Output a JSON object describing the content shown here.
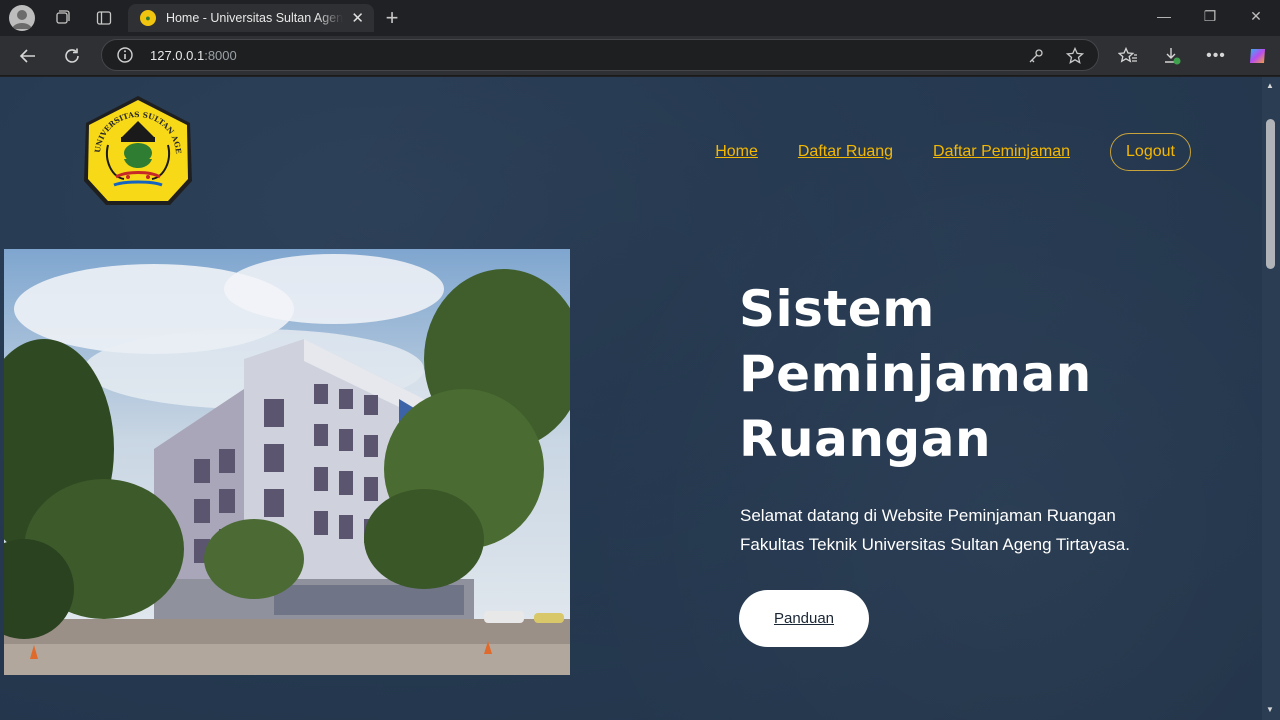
{
  "browser": {
    "tab_title": "Home - Universitas Sultan Ageng Tirtayasa",
    "tab_close": "✕",
    "new_tab": "+",
    "url_host": "127.0.0.1",
    "url_port": ":8000",
    "window_controls": {
      "minimize": "—",
      "restore": "❐",
      "close": "✕"
    }
  },
  "site": {
    "logo_text": "UNIVERSITAS SULTAN AGENG TIRTAYASA",
    "nav": {
      "home": "Home",
      "daftar_ruang": "Daftar Ruang",
      "daftar_peminjaman": "Daftar Peminjaman",
      "logout": "Logout"
    },
    "hero": {
      "headline_line1": "Sistem",
      "headline_line2": "Peminjaman",
      "headline_line3": "Ruangan",
      "welcome_line1": "Selamat datang di Website Peminjaman Ruangan",
      "welcome_line2": "Fakultas Teknik Universitas Sultan Ageng Tirtayasa.",
      "button": "Panduan"
    }
  },
  "colors": {
    "page_bg": "#263a52",
    "nav_link": "#f5b800",
    "logo_yellow": "#f7d918",
    "button_bg": "#ffffff"
  },
  "icons": [
    "profile-avatar-icon",
    "workspaces-icon",
    "tab-actions-icon",
    "back-icon",
    "reload-icon",
    "site-info-icon",
    "key-icon",
    "star-icon",
    "favorites-icon",
    "downloads-icon",
    "more-icon",
    "copilot-icon"
  ]
}
